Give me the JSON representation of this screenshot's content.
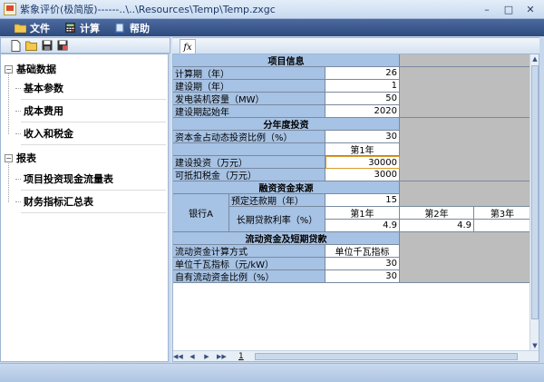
{
  "window": {
    "title": "紫象评价(极简版)------..\\..\\Resources\\Temp\\Temp.zxgc"
  },
  "menu": [
    {
      "label": "文件",
      "icon": "folder-icon"
    },
    {
      "label": "计算",
      "icon": "calculator-icon"
    },
    {
      "label": "帮助",
      "icon": "help-icon"
    }
  ],
  "left_toolbar": {
    "icons": [
      "new-icon",
      "open-icon",
      "save-icon",
      "save-as-icon"
    ]
  },
  "tree": {
    "groups": [
      {
        "label": "基础数据",
        "items": [
          "基本参数",
          "成本费用",
          "收入和税金"
        ]
      },
      {
        "label": "报表",
        "items": [
          "项目投资现金流量表",
          "财务指标汇总表"
        ]
      }
    ]
  },
  "formula_tab": "fx",
  "sheet": {
    "project_info": {
      "header": "项目信息",
      "rows": [
        {
          "label": "计算期（年）",
          "value": "26"
        },
        {
          "label": "建设期（年）",
          "value": "1"
        },
        {
          "label": "发电装机容量（MW）",
          "value": "50"
        },
        {
          "label": "建设期起始年",
          "value": "2020"
        }
      ]
    },
    "annual_investment": {
      "header": "分年度投资",
      "capital_ratio_label": "资本金占动态投资比例（%）",
      "capital_ratio_value": "30",
      "year_header": "第1年",
      "construction_label": "建设投资（万元）",
      "construction_value": "30000",
      "deductible_label": "可抵扣税金（万元）",
      "deductible_value": "3000"
    },
    "financing": {
      "header": "融资资金来源",
      "bank_label": "银行A",
      "repay_label": "预定还款期（年）",
      "repay_value": "15",
      "rate_label": "长期贷款利率（%）",
      "years": [
        "第1年",
        "第2年",
        "第3年"
      ],
      "rates": [
        "4.9",
        "4.9",
        ""
      ]
    },
    "working_capital": {
      "header": "流动资金及短期贷款",
      "rows": [
        {
          "label": "流动资金计算方式",
          "value": "单位千瓦指标"
        },
        {
          "label": "单位千瓦指标（元/kW）",
          "value": "30"
        },
        {
          "label": "自有流动资金比例（%）",
          "value": "30"
        }
      ]
    }
  },
  "sheet_tab": "1"
}
